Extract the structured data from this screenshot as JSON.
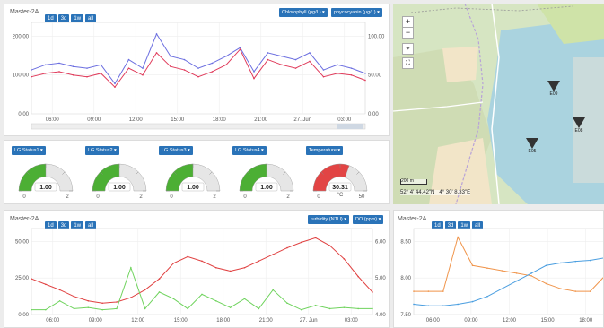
{
  "top_chart": {
    "title": "Master-2A",
    "range_buttons": [
      "1d",
      "3d",
      "1w",
      "all"
    ],
    "dropdown_left": "Chlorophyll (µg/L)",
    "dropdown_right": "phycocyanin (µg/L)",
    "scroll_label": "III",
    "chart_data": {
      "type": "line",
      "x": [
        "04:00",
        "05:00",
        "06:00",
        "07:00",
        "08:00",
        "09:00",
        "10:00",
        "11:00",
        "12:00",
        "13:00",
        "14:00",
        "15:00",
        "16:00",
        "17:00",
        "18:00",
        "19:00",
        "20:00",
        "21:00",
        "22:00",
        "23:00",
        "00:00",
        "01:00",
        "02:00",
        "03:00",
        "04:00"
      ],
      "x_tick_labels": [
        "06:00",
        "09:00",
        "12:00",
        "15:00",
        "18:00",
        "21:00",
        "27. Jun",
        "03:00"
      ],
      "y_left_ticks": [
        "0.00",
        "100.00",
        "200.00"
      ],
      "y_right_ticks": [
        "0.00",
        "50.00",
        "100.00"
      ],
      "ylim_left": [
        0,
        240
      ],
      "series": [
        {
          "axis": "left",
          "color": "#6b6ee0",
          "values": [
            120,
            135,
            140,
            130,
            125,
            135,
            80,
            150,
            125,
            225,
            160,
            150,
            125,
            140,
            160,
            185,
            115,
            170,
            160,
            150,
            170,
            120,
            135,
            125,
            110
          ]
        },
        {
          "axis": "left",
          "color": "#e03b5b",
          "values": [
            100,
            110,
            115,
            105,
            100,
            110,
            70,
            125,
            105,
            170,
            130,
            120,
            100,
            115,
            135,
            180,
            95,
            150,
            135,
            125,
            145,
            100,
            110,
            105,
            90
          ]
        }
      ]
    }
  },
  "gauges": [
    {
      "label": "I.G Status1",
      "value_text": "1.00",
      "min": "0",
      "max": "2",
      "fraction": 0.5,
      "color": "#4caf34"
    },
    {
      "label": "I.G Status2",
      "value_text": "1.00",
      "min": "0",
      "max": "2",
      "fraction": 0.5,
      "color": "#4caf34"
    },
    {
      "label": "I.G Status3",
      "value_text": "1.00",
      "min": "0",
      "max": "2",
      "fraction": 0.5,
      "color": "#4caf34"
    },
    {
      "label": "I.G Status4",
      "value_text": "1.00",
      "min": "0",
      "max": "2",
      "fraction": 0.5,
      "color": "#4caf34"
    },
    {
      "label": "Temperature",
      "value_text": "30.31",
      "unit": "°C",
      "min": "0",
      "max": "50",
      "fraction": 0.61,
      "color": "#e24444"
    }
  ],
  "map": {
    "zoom_in": "+",
    "zoom_out": "−",
    "scale_label": "200 m",
    "coords": "52° 4' 44.42\"N   4° 30' 8.33\"E",
    "sensors": [
      "E09",
      "E08",
      "E05"
    ]
  },
  "bottom_left_chart": {
    "title": "Master-2A",
    "range_buttons": [
      "1d",
      "3d",
      "1w",
      "all"
    ],
    "dropdown_left": "turbidity (NTU)",
    "dropdown_right": "DO (ppm)",
    "chart_data": {
      "type": "line",
      "x_tick_labels": [
        "06:00",
        "09:00",
        "12:00",
        "15:00",
        "18:00",
        "21:00",
        "27. Jun",
        "03:00"
      ],
      "y_left_ticks": [
        "0.00",
        "25.00",
        "50.00"
      ],
      "y_right_ticks": [
        "4.00",
        "5.00",
        "6.00"
      ],
      "series": [
        {
          "axis": "left",
          "color": "#e04040",
          "values": [
            30,
            25,
            20,
            14,
            10,
            8,
            9,
            13,
            20,
            30,
            44,
            50,
            46,
            40,
            37,
            40,
            46,
            52,
            58,
            63,
            67,
            60,
            48,
            32,
            18
          ]
        },
        {
          "axis": "left",
          "color": "#6fd35d",
          "values": [
            2,
            2,
            10,
            3,
            4,
            2,
            3,
            40,
            3,
            18,
            12,
            3,
            16,
            10,
            4,
            12,
            3,
            20,
            8,
            2,
            6,
            3,
            4,
            3,
            3
          ]
        }
      ]
    }
  },
  "bottom_right_chart": {
    "title": "Master-2A",
    "range_buttons": [
      "1d",
      "3d",
      "1w",
      "all"
    ],
    "chart_data": {
      "type": "line",
      "x_tick_labels": [
        "06:00",
        "09:00",
        "12:00",
        "15:00",
        "18:00"
      ],
      "y_left_ticks": [
        "7.50",
        "8.00",
        "8.50"
      ],
      "series": [
        {
          "axis": "left",
          "color": "#f0944a",
          "values": [
            7.8,
            7.8,
            7.8,
            8.85,
            8.3,
            8.25,
            8.2,
            8.15,
            8.1,
            7.95,
            7.85,
            7.8,
            7.8,
            8.1
          ]
        },
        {
          "axis": "left",
          "color": "#4a9ee0",
          "values": [
            7.55,
            7.52,
            7.52,
            7.55,
            7.6,
            7.7,
            7.85,
            8.0,
            8.15,
            8.3,
            8.35,
            8.38,
            8.4,
            8.45
          ]
        }
      ]
    }
  }
}
